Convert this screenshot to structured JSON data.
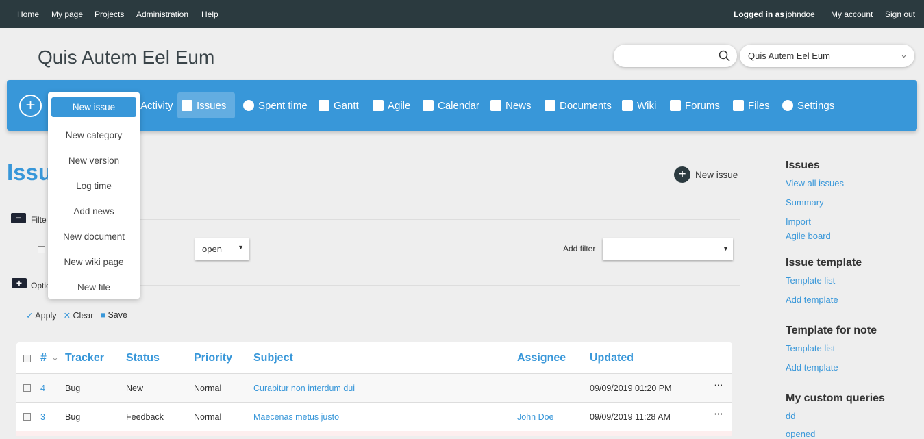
{
  "topbar": {
    "left": [
      "Home",
      "My page",
      "Projects",
      "Administration",
      "Help"
    ],
    "logged_in_as": "Logged in as",
    "user": "johndoe",
    "my_account": "My account",
    "sign_out": "Sign out"
  },
  "project_title": "Quis Autem Eel Eum",
  "project_select": "Quis Autem Eel Eum",
  "nav": [
    {
      "label": "Activity"
    },
    {
      "label": "Issues",
      "active": true
    },
    {
      "label": "Spent time"
    },
    {
      "label": "Gantt"
    },
    {
      "label": "Agile"
    },
    {
      "label": "Calendar"
    },
    {
      "label": "News"
    },
    {
      "label": "Documents"
    },
    {
      "label": "Wiki"
    },
    {
      "label": "Forums"
    },
    {
      "label": "Files"
    },
    {
      "label": "Settings"
    }
  ],
  "new_menu": [
    "New issue",
    "New category",
    "New version",
    "Log time",
    "Add news",
    "New document",
    "New wiki page",
    "New file"
  ],
  "page_heading": "Issu",
  "new_issue_button": "New issue",
  "filters": {
    "label": "Filte",
    "status_value": "open",
    "add_filter": "Add filter"
  },
  "options_label": "Optic",
  "actions": {
    "apply": "Apply",
    "clear": "Clear",
    "save": "Save"
  },
  "table": {
    "headers": [
      "#",
      "Tracker",
      "Status",
      "Priority",
      "Subject",
      "Assignee",
      "Updated"
    ],
    "rows": [
      {
        "id": "4",
        "tracker": "Bug",
        "status": "New",
        "priority": "Normal",
        "subject": "Curabitur non interdum dui",
        "assignee": "",
        "updated": "09/09/2019 01:20 PM"
      },
      {
        "id": "3",
        "tracker": "Bug",
        "status": "Feedback",
        "priority": "Normal",
        "subject": "Maecenas metus justo",
        "assignee": "John Doe",
        "updated": "09/09/2019 11:28 AM"
      }
    ]
  },
  "sidebar": {
    "issues_title": "Issues",
    "issues_links": [
      "View all issues",
      "Summary",
      "Import",
      "Agile board"
    ],
    "template_title": "Issue template",
    "template_links": [
      "Template list",
      "Add template"
    ],
    "note_title": "Template for note",
    "note_links": [
      "Template list",
      "Add template"
    ],
    "queries_title": "My custom queries",
    "queries_links": [
      "dd",
      "opened"
    ]
  },
  "colors": {
    "accent": "#3897d9",
    "topbar": "#2b3a3f"
  }
}
